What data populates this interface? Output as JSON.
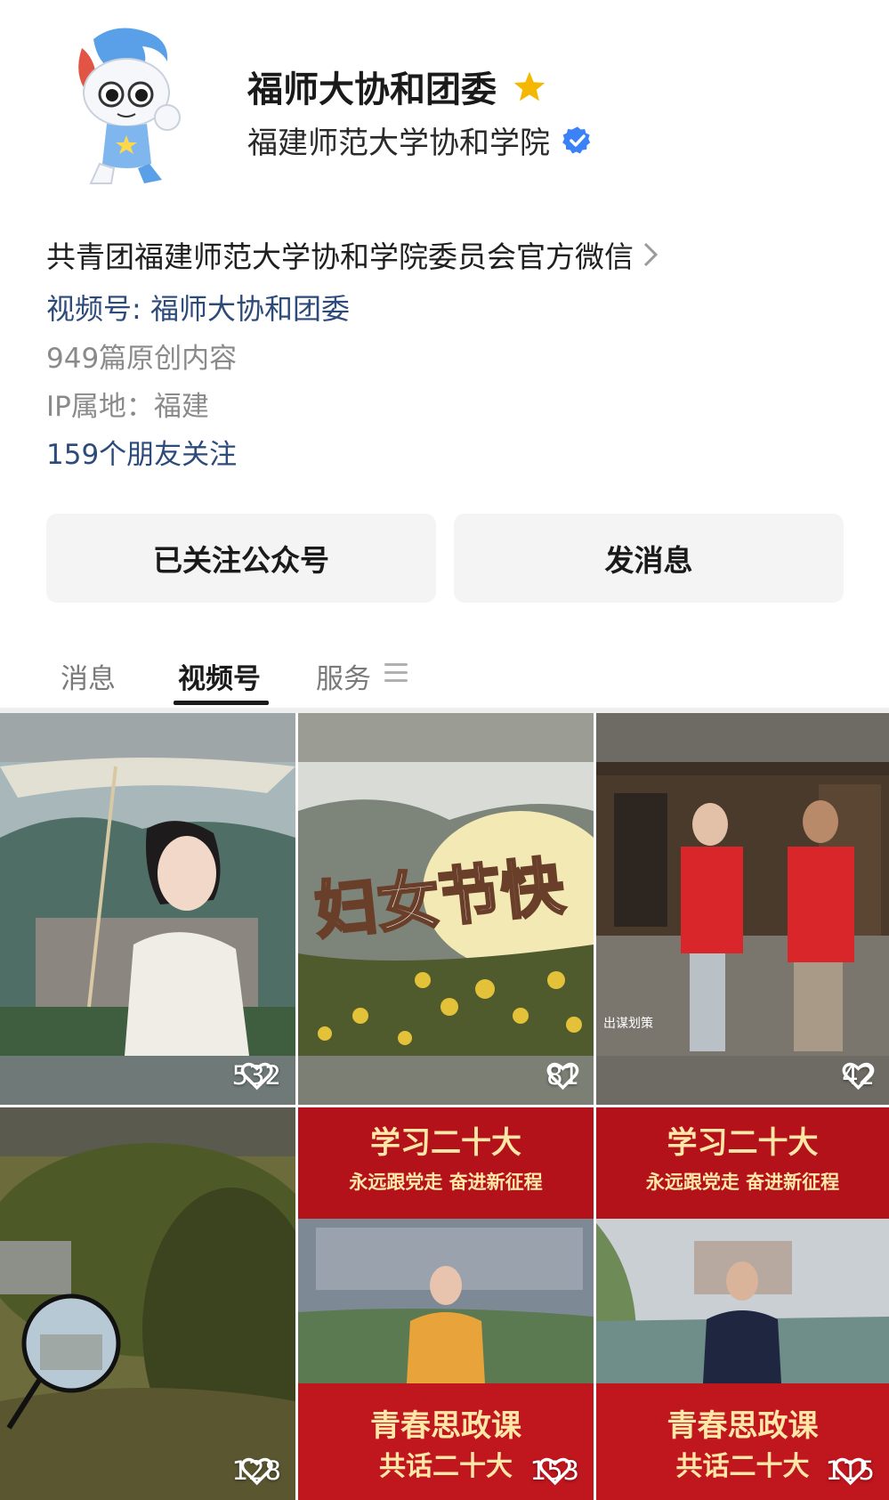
{
  "account": {
    "name": "福师大协和团委",
    "subject": "福建师范大学协和学院",
    "description": "共青团福建师范大学协和学院委员会官方微信",
    "channel": "视频号: 福师大协和团委",
    "original_count": "949篇原创内容",
    "ip_location": "IP属地：福建",
    "friends_follow": "159个朋友关注"
  },
  "buttons": {
    "follow": "已关注公众号",
    "message": "发消息"
  },
  "tabs": [
    {
      "label": "消息",
      "active": false
    },
    {
      "label": "视频号",
      "active": true
    },
    {
      "label": "服务",
      "active": false
    }
  ],
  "videos": [
    {
      "likes": "532",
      "theme": "umbrella-girl"
    },
    {
      "likes": "81",
      "overlay": "妇女节快"
    },
    {
      "likes": "42",
      "caption": "出谋划策"
    },
    {
      "likes": "128",
      "theme": "tree-mirror"
    },
    {
      "likes": "153",
      "banner_top": "学习二十大",
      "banner_sub": "永远跟党走 奋进新征程",
      "banner_bottom": "青春思政课",
      "banner_bottom2": "共话二十大"
    },
    {
      "likes": "115",
      "banner_top": "学习二十大",
      "banner_sub": "永远跟党走 奋进新征程",
      "banner_bottom": "青春思政课",
      "banner_bottom2": "共话二十大"
    }
  ],
  "colors": {
    "accent_link": "#2c4a7a",
    "verified": "#3b82f6",
    "star": "#f5b800",
    "banner_red": "#b3121b"
  }
}
